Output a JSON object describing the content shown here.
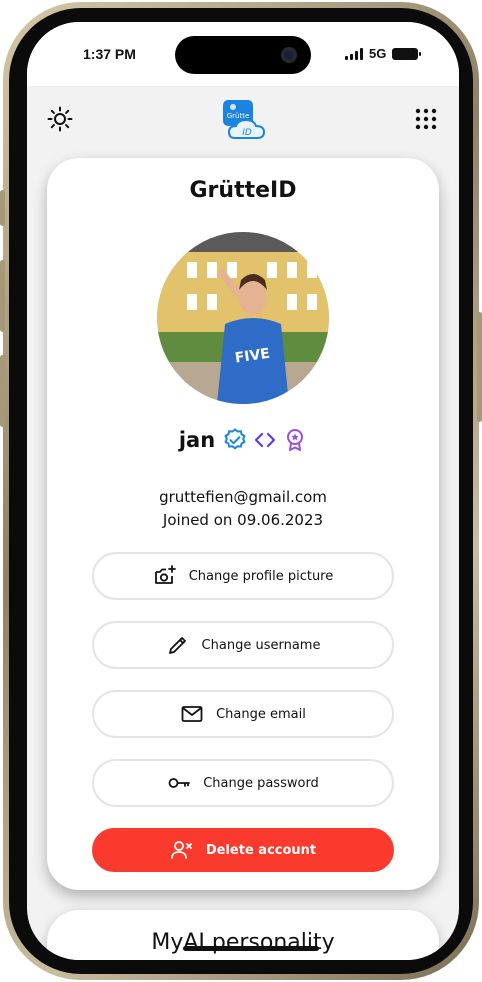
{
  "status_bar": {
    "time": "1:37 PM",
    "network": "5G"
  },
  "app_bar": {
    "logo_text": "Grütte",
    "logo_sub": "ID"
  },
  "profile_card": {
    "title": "GrütteID",
    "username": "jan",
    "email": "gruttefien@gmail.com",
    "joined": "Joined on 09.06.2023",
    "badges": [
      "verified-icon",
      "code-icon",
      "award-icon"
    ]
  },
  "actions": {
    "change_picture": "Change profile picture",
    "change_username": "Change username",
    "change_email": "Change email",
    "change_password": "Change password",
    "delete_account": "Delete account"
  },
  "second_card": {
    "title": "MyAI personality"
  },
  "colors": {
    "accent_blue": "#1b84e0",
    "badge_purple": "#7b3fe4",
    "danger_red": "#fb3a2e",
    "background": "#f2f2f2"
  }
}
